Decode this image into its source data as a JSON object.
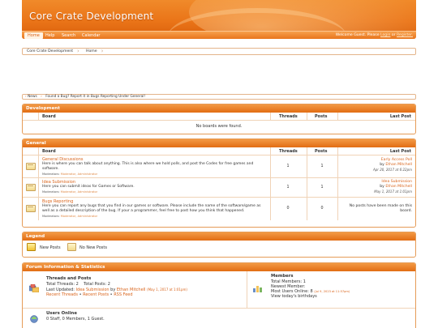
{
  "header": {
    "site_title": "Core Crate Development",
    "nav": [
      "Home",
      "Help",
      "Search",
      "Calendar"
    ],
    "welcome_prefix": "Welcome Guest. Please",
    "login": "Login",
    "or": "or",
    "register": "Register."
  },
  "breadcrumb": [
    "Core Crate Development",
    "Home"
  ],
  "notice": {
    "label": "News",
    "text": "Found a Bug? Report it in Bugs Reporting Under General!"
  },
  "columns": {
    "board": "Board",
    "threads": "Threads",
    "posts": "Posts",
    "last_post": "Last Post"
  },
  "development": {
    "title": "Development",
    "empty": "No boards were found."
  },
  "general": {
    "title": "General",
    "boards": [
      {
        "title": "General Discussions",
        "desc1": "Here is where you can talk about anything. This is also where we hold polls, and post the Codes for free games and",
        "desc2": "software.",
        "mods_label": "Moderators:",
        "mods": "Moderator, Administrator",
        "threads": "1",
        "posts": "1",
        "last_title": "Early Access Poll",
        "last_by": "by",
        "last_user": "Ethan Mitchell",
        "last_date": "Apr 20, 2017 at 6:22pm"
      },
      {
        "title": "Idea Submission",
        "desc1": "Here you can submit ideas for Games or Software.",
        "desc2": "",
        "mods_label": "Moderators:",
        "mods": "Moderator, Administrator",
        "threads": "1",
        "posts": "1",
        "last_title": "Idea Submission",
        "last_by": "by",
        "last_user": "Ethan Mitchell",
        "last_date": "May 1, 2017 at 1:01pm"
      },
      {
        "title": "Bugs Reporting",
        "desc1": "Here you can report any bugs that you find in our games or software. Please include the name of the software/game as",
        "desc2": "well as a detailed description of the bug. If your a programmer, feel free to post how you think that happened.",
        "mods_label": "Moderators:",
        "mods": "Moderator, Administrator",
        "threads": "0",
        "posts": "0",
        "none1": "No posts have been made on this",
        "none2": "board."
      }
    ]
  },
  "legend": {
    "title": "Legend",
    "new_posts": "New Posts",
    "no_new_posts": "No New Posts"
  },
  "stats": {
    "title": "Forum Information & Statistics",
    "threads_posts_title": "Threads and Posts",
    "total_threads": "Total Threads: 2",
    "total_posts": "Total Posts: 2",
    "last_updated_label": "Last Updated:",
    "last_updated_thread": "Idea Submission",
    "by": "by",
    "last_updated_user": "Ethan Mitchell",
    "last_updated_date": "(May 1, 2017 at 1:01pm)",
    "recent_threads": "Recent Threads",
    "recent_posts": "Recent Posts",
    "rss": "RSS Feed",
    "dot": "•",
    "members_title": "Members",
    "total_members": "Total Members: 1",
    "newest_member": "Newest Member:",
    "most_online": "Most Users Online: 8",
    "most_online_date": "(Jul 9, 2023 at 11:57pm)",
    "birthdays": "View today's birthdays",
    "online_title": "Users Online",
    "online_text": "0 Staff, 0 Members, 1 Guest."
  },
  "colors": {
    "accent": "#e8751c",
    "link": "#d9631a",
    "border": "#e59b57"
  }
}
